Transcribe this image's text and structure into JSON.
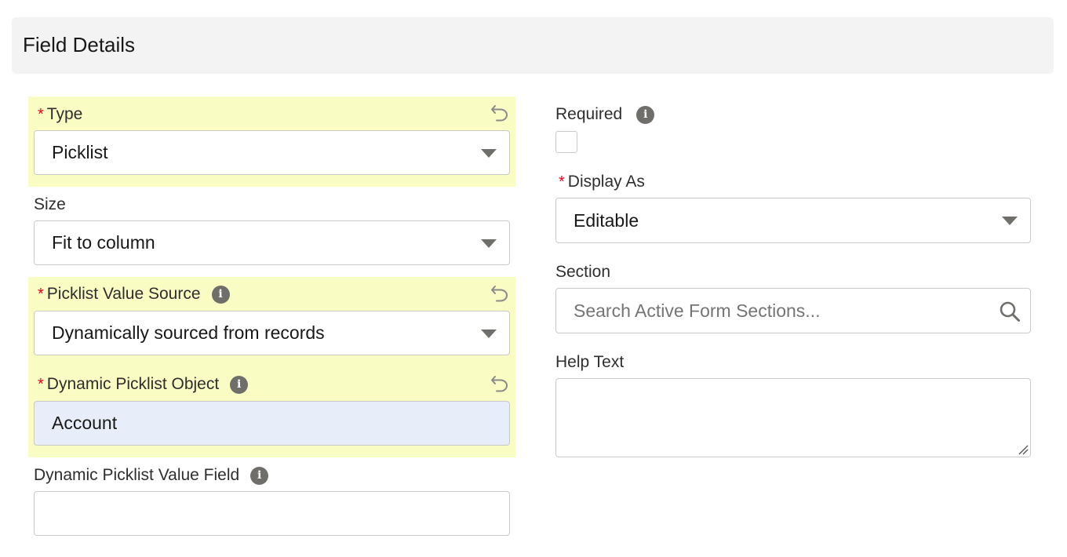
{
  "header": {
    "title": "Field Details"
  },
  "colors": {
    "highlight": "#f9fcc3",
    "required": "#ea001e",
    "filled_input": "#e8eef9",
    "icon": "#706e6b"
  },
  "left": {
    "type": {
      "label": "Type",
      "required": true,
      "value": "Picklist",
      "undo_icon": "undo-icon"
    },
    "size": {
      "label": "Size",
      "value": "Fit to column"
    },
    "picklist_source": {
      "label": "Picklist Value Source",
      "required": true,
      "value": "Dynamically sourced from records",
      "info_icon": "info-icon",
      "undo_icon": "undo-icon"
    },
    "dynamic_object": {
      "label": "Dynamic Picklist Object",
      "required": true,
      "value": "Account",
      "info_icon": "info-icon",
      "undo_icon": "undo-icon"
    },
    "dynamic_value_field": {
      "label": "Dynamic Picklist Value Field",
      "value": "",
      "info_icon": "info-icon"
    }
  },
  "right": {
    "required_field": {
      "label": "Required",
      "checked": false,
      "info_icon": "info-icon"
    },
    "display_as": {
      "label": "Display As",
      "required": true,
      "value": "Editable"
    },
    "section": {
      "label": "Section",
      "placeholder": "Search Active Form Sections...",
      "icon": "search-icon"
    },
    "help_text": {
      "label": "Help Text",
      "value": ""
    }
  },
  "glyphs": {
    "required_marker": "*",
    "info_glyph": "i"
  }
}
